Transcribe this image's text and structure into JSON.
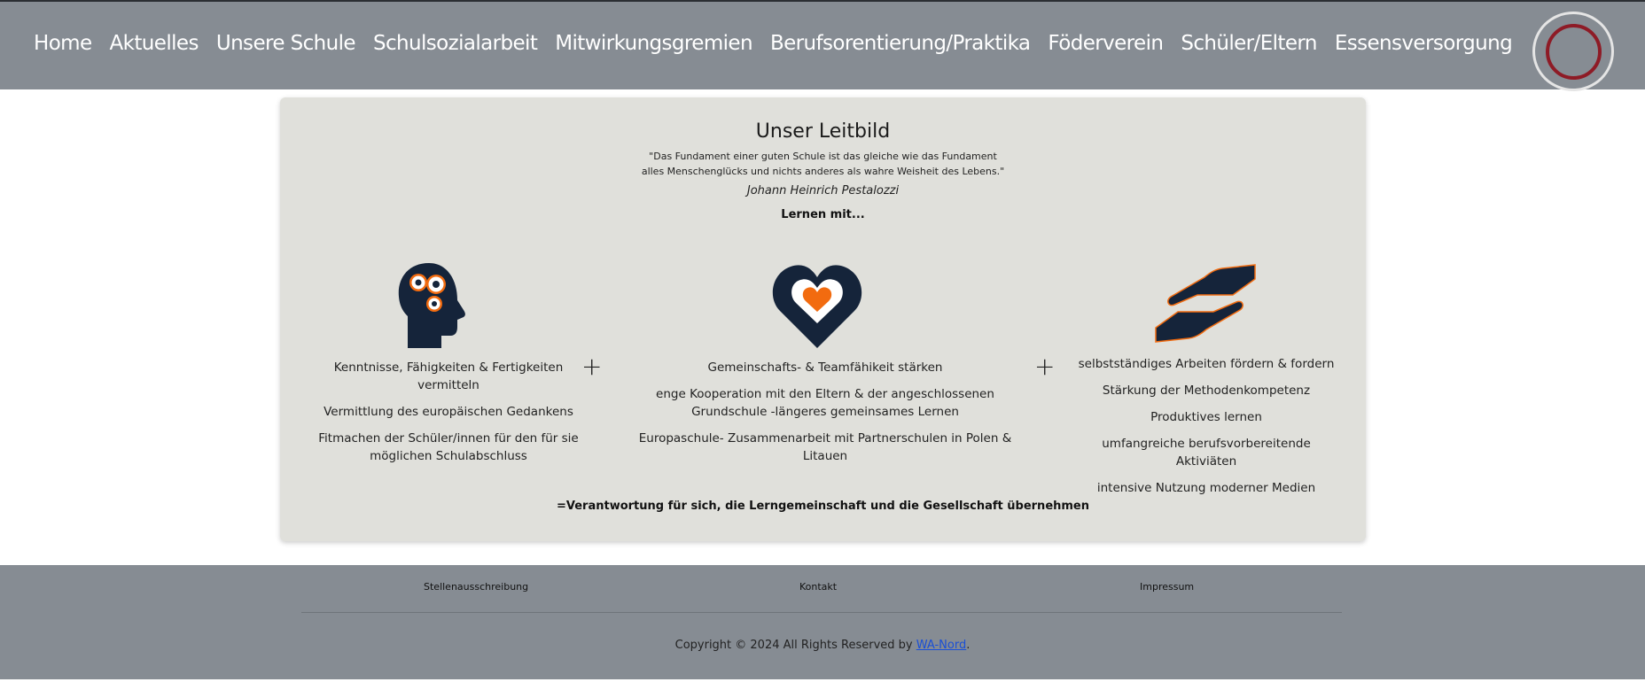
{
  "nav": {
    "items": [
      {
        "label": "Home"
      },
      {
        "label": "Aktuelles"
      },
      {
        "label": "Unsere Schule"
      },
      {
        "label": "Schulsozialarbeit"
      },
      {
        "label": "Mitwirkungsgremien"
      },
      {
        "label": "Berufsorentierung/Praktika"
      },
      {
        "label": "Föderverein"
      },
      {
        "label": "Schüler/Eltern"
      },
      {
        "label": "Essensversorgung"
      }
    ]
  },
  "card": {
    "title": "Unser Leitbild",
    "quote_line1": "\"Das Fundament einer guten Schule ist das gleiche wie das Fundament",
    "quote_line2": "alles Menschenglücks und nichts anderes als wahre Weisheit des Lebens.\"",
    "author": "Johann Heinrich Pestalozzi",
    "lernen": "Lernen mit...",
    "plus": "+",
    "columns": [
      {
        "icon": "head-gears-icon",
        "items": [
          "Kenntnisse, Fähigkeiten & Fertigkeiten vermitteln",
          "Vermittlung des europäischen Gedankens",
          "Fitmachen der Schüler/innen für den für sie möglichen Schulabschluss"
        ]
      },
      {
        "icon": "heart-icon",
        "items": [
          "Gemeinschafts- & Teamfähikeit stärken",
          "enge Kooperation mit den Eltern & der angeschlossenen Grundschule -längeres gemeinsames Lernen",
          "Europaschule- Zusammenarbeit mit Partnerschulen in Polen & Litauen"
        ]
      },
      {
        "icon": "hands-icon",
        "items": [
          "selbstständiges Arbeiten fördern & fordern",
          "Stärkung der Methodenkompetenz",
          "Produktives lernen",
          "umfangreiche berufsvorbereitende Aktiviäten",
          "intensive Nutzung moderner Medien"
        ]
      }
    ],
    "summary": "=Verantwortung für sich, die Lerngemeinschaft und die Gesellschaft übernehmen"
  },
  "colors": {
    "nav_bg": "#868c93",
    "card_bg": "#e0e0db",
    "icon_dark": "#15243a",
    "accent_orange": "#f26b0f",
    "logo_ring": "#8e1b26"
  },
  "footer": {
    "links": [
      "Stellenausschreibung",
      "Kontakt",
      "Impressum"
    ],
    "copyright_text": "Copyright © 2024 All Rights Reserved by ",
    "copyright_link": "WA-Nord",
    "copyright_end": "."
  }
}
